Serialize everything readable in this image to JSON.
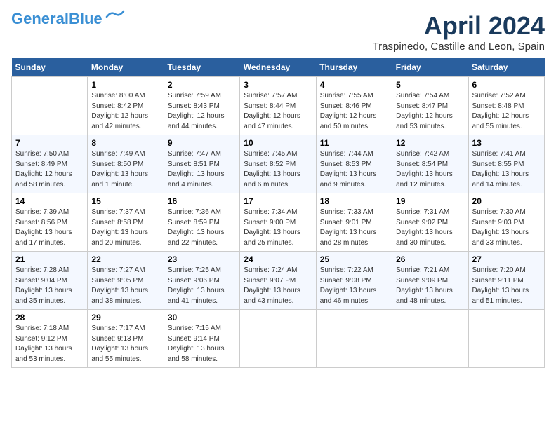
{
  "header": {
    "logo_general": "General",
    "logo_blue": "Blue",
    "month": "April 2024",
    "location": "Traspinedo, Castille and Leon, Spain"
  },
  "columns": [
    "Sunday",
    "Monday",
    "Tuesday",
    "Wednesday",
    "Thursday",
    "Friday",
    "Saturday"
  ],
  "weeks": [
    [
      {
        "day": "",
        "info": ""
      },
      {
        "day": "1",
        "info": "Sunrise: 8:00 AM\nSunset: 8:42 PM\nDaylight: 12 hours\nand 42 minutes."
      },
      {
        "day": "2",
        "info": "Sunrise: 7:59 AM\nSunset: 8:43 PM\nDaylight: 12 hours\nand 44 minutes."
      },
      {
        "day": "3",
        "info": "Sunrise: 7:57 AM\nSunset: 8:44 PM\nDaylight: 12 hours\nand 47 minutes."
      },
      {
        "day": "4",
        "info": "Sunrise: 7:55 AM\nSunset: 8:46 PM\nDaylight: 12 hours\nand 50 minutes."
      },
      {
        "day": "5",
        "info": "Sunrise: 7:54 AM\nSunset: 8:47 PM\nDaylight: 12 hours\nand 53 minutes."
      },
      {
        "day": "6",
        "info": "Sunrise: 7:52 AM\nSunset: 8:48 PM\nDaylight: 12 hours\nand 55 minutes."
      }
    ],
    [
      {
        "day": "7",
        "info": "Sunrise: 7:50 AM\nSunset: 8:49 PM\nDaylight: 12 hours\nand 58 minutes."
      },
      {
        "day": "8",
        "info": "Sunrise: 7:49 AM\nSunset: 8:50 PM\nDaylight: 13 hours\nand 1 minute."
      },
      {
        "day": "9",
        "info": "Sunrise: 7:47 AM\nSunset: 8:51 PM\nDaylight: 13 hours\nand 4 minutes."
      },
      {
        "day": "10",
        "info": "Sunrise: 7:45 AM\nSunset: 8:52 PM\nDaylight: 13 hours\nand 6 minutes."
      },
      {
        "day": "11",
        "info": "Sunrise: 7:44 AM\nSunset: 8:53 PM\nDaylight: 13 hours\nand 9 minutes."
      },
      {
        "day": "12",
        "info": "Sunrise: 7:42 AM\nSunset: 8:54 PM\nDaylight: 13 hours\nand 12 minutes."
      },
      {
        "day": "13",
        "info": "Sunrise: 7:41 AM\nSunset: 8:55 PM\nDaylight: 13 hours\nand 14 minutes."
      }
    ],
    [
      {
        "day": "14",
        "info": "Sunrise: 7:39 AM\nSunset: 8:56 PM\nDaylight: 13 hours\nand 17 minutes."
      },
      {
        "day": "15",
        "info": "Sunrise: 7:37 AM\nSunset: 8:58 PM\nDaylight: 13 hours\nand 20 minutes."
      },
      {
        "day": "16",
        "info": "Sunrise: 7:36 AM\nSunset: 8:59 PM\nDaylight: 13 hours\nand 22 minutes."
      },
      {
        "day": "17",
        "info": "Sunrise: 7:34 AM\nSunset: 9:00 PM\nDaylight: 13 hours\nand 25 minutes."
      },
      {
        "day": "18",
        "info": "Sunrise: 7:33 AM\nSunset: 9:01 PM\nDaylight: 13 hours\nand 28 minutes."
      },
      {
        "day": "19",
        "info": "Sunrise: 7:31 AM\nSunset: 9:02 PM\nDaylight: 13 hours\nand 30 minutes."
      },
      {
        "day": "20",
        "info": "Sunrise: 7:30 AM\nSunset: 9:03 PM\nDaylight: 13 hours\nand 33 minutes."
      }
    ],
    [
      {
        "day": "21",
        "info": "Sunrise: 7:28 AM\nSunset: 9:04 PM\nDaylight: 13 hours\nand 35 minutes."
      },
      {
        "day": "22",
        "info": "Sunrise: 7:27 AM\nSunset: 9:05 PM\nDaylight: 13 hours\nand 38 minutes."
      },
      {
        "day": "23",
        "info": "Sunrise: 7:25 AM\nSunset: 9:06 PM\nDaylight: 13 hours\nand 41 minutes."
      },
      {
        "day": "24",
        "info": "Sunrise: 7:24 AM\nSunset: 9:07 PM\nDaylight: 13 hours\nand 43 minutes."
      },
      {
        "day": "25",
        "info": "Sunrise: 7:22 AM\nSunset: 9:08 PM\nDaylight: 13 hours\nand 46 minutes."
      },
      {
        "day": "26",
        "info": "Sunrise: 7:21 AM\nSunset: 9:09 PM\nDaylight: 13 hours\nand 48 minutes."
      },
      {
        "day": "27",
        "info": "Sunrise: 7:20 AM\nSunset: 9:11 PM\nDaylight: 13 hours\nand 51 minutes."
      }
    ],
    [
      {
        "day": "28",
        "info": "Sunrise: 7:18 AM\nSunset: 9:12 PM\nDaylight: 13 hours\nand 53 minutes."
      },
      {
        "day": "29",
        "info": "Sunrise: 7:17 AM\nSunset: 9:13 PM\nDaylight: 13 hours\nand 55 minutes."
      },
      {
        "day": "30",
        "info": "Sunrise: 7:15 AM\nSunset: 9:14 PM\nDaylight: 13 hours\nand 58 minutes."
      },
      {
        "day": "",
        "info": ""
      },
      {
        "day": "",
        "info": ""
      },
      {
        "day": "",
        "info": ""
      },
      {
        "day": "",
        "info": ""
      }
    ]
  ]
}
